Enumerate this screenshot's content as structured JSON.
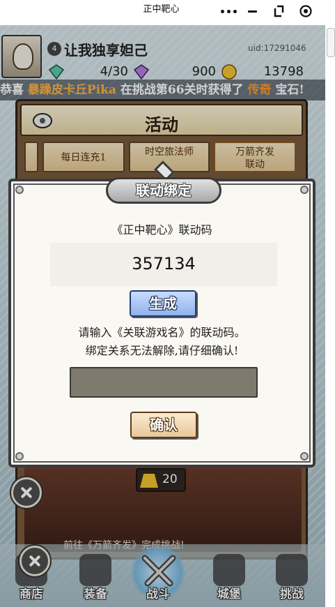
{
  "window": {
    "title": "正中靶心"
  },
  "player": {
    "name": "让我独享妲己",
    "level": "4",
    "uid": "uid:17291046",
    "resources": [
      {
        "icon": "green-gem-icon",
        "value": "4/30"
      },
      {
        "icon": "purple-gem-icon",
        "value": "900"
      },
      {
        "icon": "gold-coin-icon",
        "value": "13798"
      }
    ]
  },
  "marquee": {
    "prefix": "恭喜 ",
    "player": "暴躁皮卡丘Pika",
    "middle": " 在挑战第66关时获得了 ",
    "item": "传奇",
    "suffix": " 宝石!"
  },
  "activity": {
    "title": "活动",
    "tabs": [
      "每日连充1",
      "时空旅法师",
      "万箭齐发",
      "联动"
    ],
    "reward_value": "20",
    "go_text": "前往《万箭齐发》完成挑战!"
  },
  "modal": {
    "title": "联动绑定",
    "code_label": "《正中靶心》联动码",
    "code": "357134",
    "generate_label": "生成",
    "instruction_line1": "请输入《关联游戏名》的联动码。",
    "instruction_line2": "绑定关系无法解除,请仔细确认!",
    "confirm_label": "确认",
    "input_value": ""
  },
  "nav": [
    {
      "label": "商店",
      "icon": "shop-bag-icon"
    },
    {
      "label": "装备",
      "icon": "backpack-icon"
    },
    {
      "label": "战斗",
      "icon": "crossed-swords-icon"
    },
    {
      "label": "城堡",
      "icon": "castle-icon"
    },
    {
      "label": "挑战",
      "icon": "locked-armor-icon"
    }
  ],
  "colors": {
    "accent_orange": "#ffb340",
    "generate_button": "#8fb2ee",
    "confirm_button": "#e8c79a",
    "input_bg": "#7e7a6e"
  }
}
